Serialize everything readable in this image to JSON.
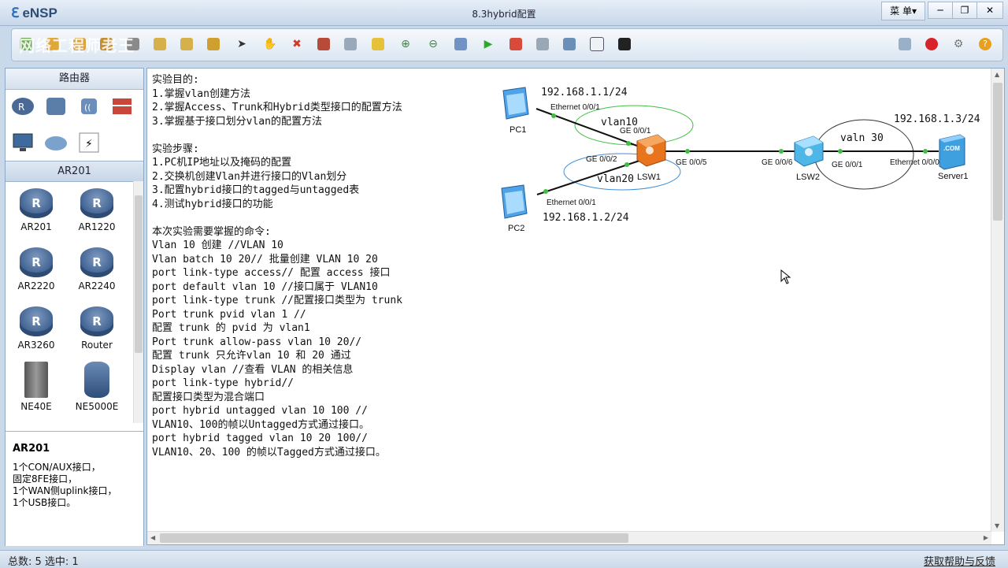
{
  "app": {
    "logo": "eNSP",
    "title": "8.3hybrid配置",
    "menu_label": "菜 单▾",
    "min": "─",
    "max": "❐",
    "close": "✕"
  },
  "watermark": "网络工程师老王",
  "toolbar": {
    "icons": [
      "new-topology-icon",
      "open-icon",
      "save-icon",
      "save-as-icon",
      "print-icon",
      "undo-icon",
      "redo-icon",
      "select-icon",
      "hand-icon",
      "delete-icon",
      "delete-link-icon",
      "text-icon",
      "rect-icon",
      "zoom-in-icon",
      "zoom-out-icon",
      "fit-icon",
      "start-icon",
      "stop-icon",
      "capture-icon",
      "topology-icon",
      "panel-icon",
      "console-icon",
      "chat-icon",
      "huawei-icon",
      "settings-icon",
      "help-icon"
    ]
  },
  "left_panel": {
    "category_title": "路由器",
    "sub_title": "AR201",
    "devices": [
      "AR201",
      "AR1220",
      "AR2220",
      "AR2240",
      "AR3260",
      "Router",
      "NE40E",
      "NE5000E"
    ],
    "desc_title": "AR201",
    "desc_lines": [
      "1个CON/AUX接口，",
      "固定8FE接口，",
      "1个WAN侧uplink接口，",
      "1个USB接口。"
    ]
  },
  "notes": [
    "实验目的:",
    "1.掌握vlan创建方法",
    "2.掌握Access、Trunk和Hybrid类型接口的配置方法",
    "3.掌握基于接口划分vlan的配置方法",
    "",
    "实验步骤:",
    "1.PC机IP地址以及掩码的配置",
    "2.交换机创建Vlan并进行接口的Vlan划分",
    "3.配置hybrid接口的tagged与untagged表",
    "4.测试hybrid接口的功能",
    "",
    "本次实验需要掌握的命令:",
    "Vlan 10 创建 //VLAN 10",
    "Vlan batch 10 20// 批量创建 VLAN 10 20",
    "port link-type access// 配置 access 接口",
    "port default vlan 10 //接口属于 VLAN10",
    "port link-type trunk //配置接口类型为 trunk",
    "Port trunk pvid vlan 1 //",
    "配置 trunk 的 pvid 为 vlan1",
    "Port trunk allow-pass vlan 10 20//",
    "配置 trunk 只允许vlan 10 和 20 通过",
    "Display vlan //查看 VLAN 的相关信息",
    "port link-type hybrid//",
    "配置接口类型为混合端口",
    "port hybrid untagged vlan 10 100 //",
    "VLAN10、100的帧以Untagged方式通过接口。",
    "port hybrid tagged vlan 10 20 100//",
    "VLAN10、20、100 的帧以Tagged方式通过接口。"
  ],
  "topology": {
    "pc1": {
      "name": "PC1",
      "ip": "192.168.1.1/24",
      "port": "Ethernet 0/0/1"
    },
    "pc2": {
      "name": "PC2",
      "ip": "192.168.1.2/24",
      "port": "Ethernet 0/0/1"
    },
    "lsw1": {
      "name": "LSW1",
      "p1": "GE 0/0/1",
      "p2": "GE 0/0/2",
      "p5": "GE 0/0/5"
    },
    "lsw2": {
      "name": "LSW2",
      "p6": "GE 0/0/6",
      "p1": "GE 0/0/1"
    },
    "server": {
      "name": "Server1",
      "ip": "192.168.1.3/24",
      "port": "Ethernet 0/0/0",
      "badge": ".COM"
    },
    "vlan10": "vlan10",
    "vlan20": "vlan20",
    "vlan30": "valn 30"
  },
  "status": {
    "left": "总数: 5 选中: 1",
    "right": "获取帮助与反馈"
  },
  "colors": {
    "vlan10_ring": "#3fbf3f",
    "vlan20_ring": "#3f8fd8",
    "vlan30_ring": "#333333",
    "switch": "#e8741e",
    "link_dot": "#3fbf3f"
  }
}
